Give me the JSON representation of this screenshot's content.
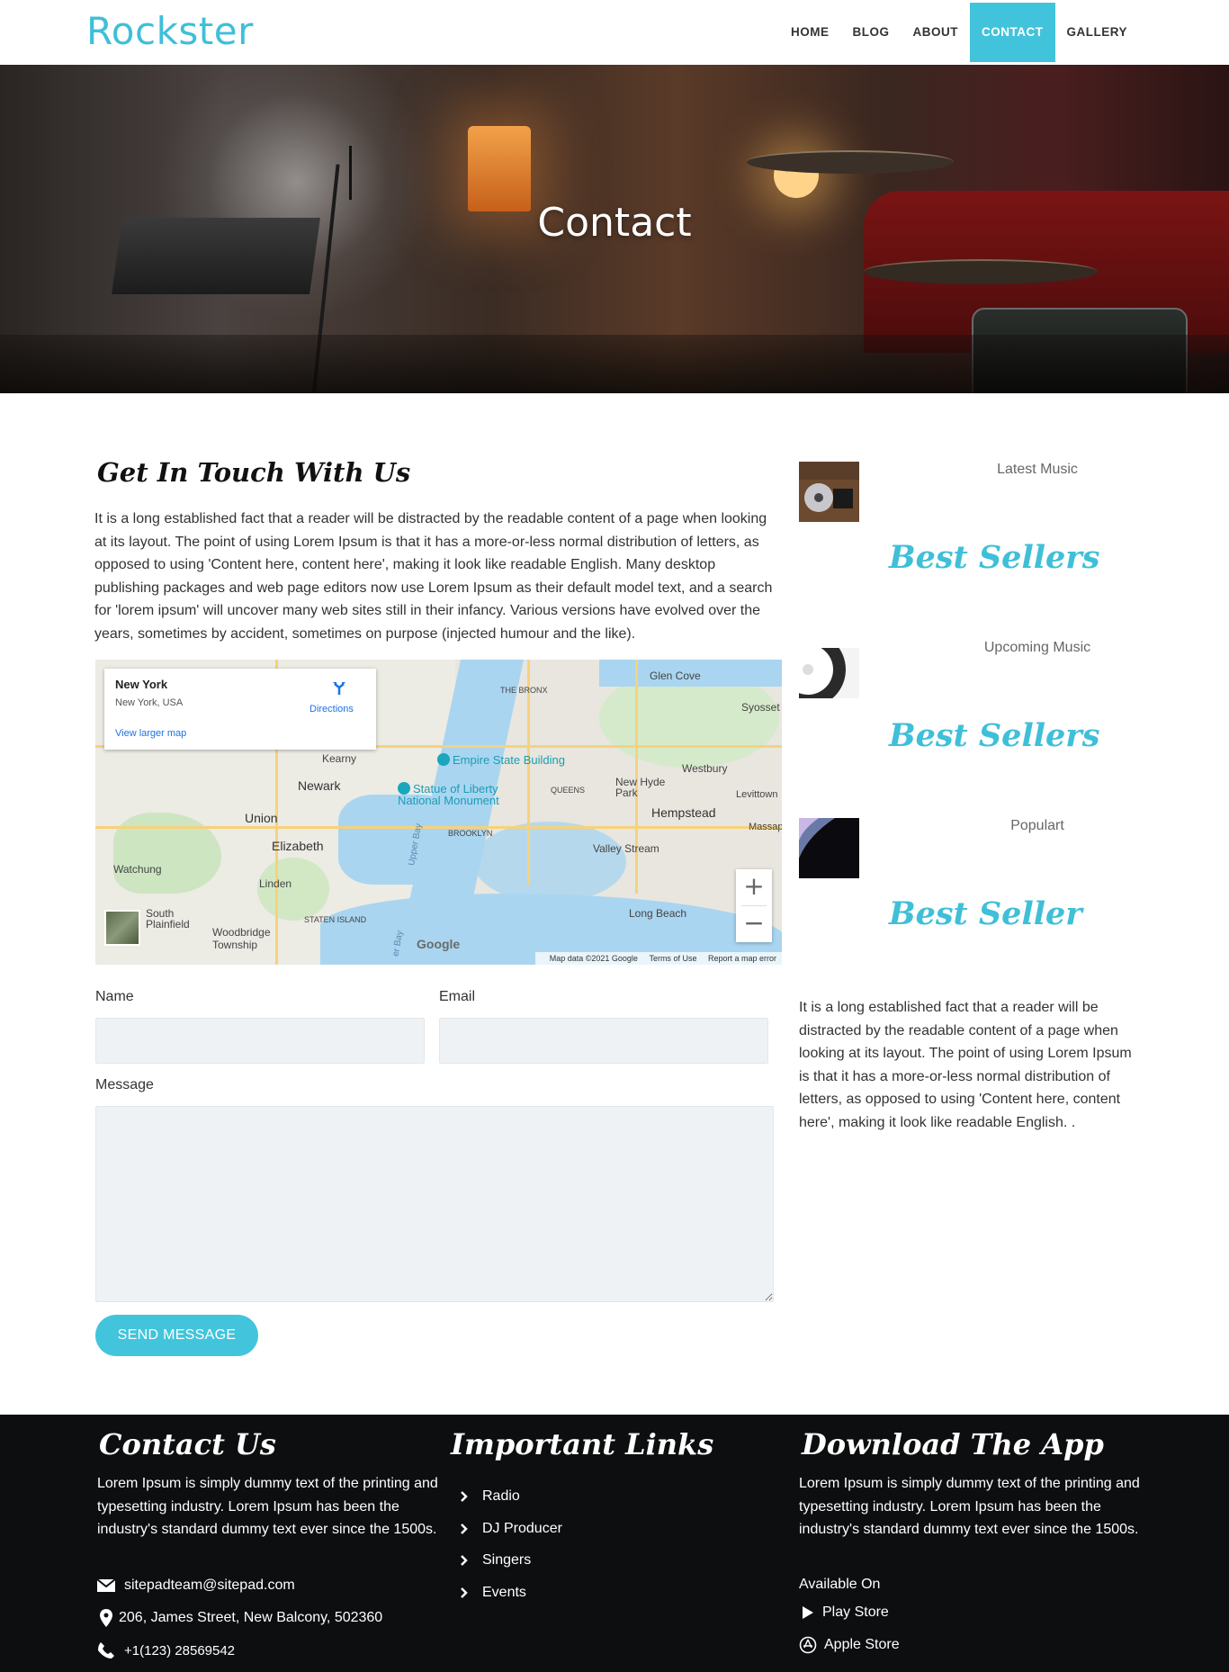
{
  "header": {
    "logo": "Rockster",
    "nav": [
      {
        "label": "HOME",
        "active": false
      },
      {
        "label": "BLOG",
        "active": false
      },
      {
        "label": "ABOUT",
        "active": false
      },
      {
        "label": "CONTACT",
        "active": true
      },
      {
        "label": "GALLERY",
        "active": false
      }
    ]
  },
  "hero": {
    "title": "Contact"
  },
  "main": {
    "title": "Get In Touch With Us",
    "intro": "It is a long established fact that a reader will be distracted by the readable content of a page when looking at its layout. The point of using Lorem Ipsum is that it has a more-or-less normal distribution of letters, as opposed to using 'Content here, content here', making it look like readable English. Many desktop publishing packages and web page editors now use Lorem Ipsum as their default model text, and a search for 'lorem ipsum' will uncover many web sites still in their infancy. Various versions have evolved over the years, sometimes by accident, sometimes on purpose (injected humour and the like)."
  },
  "map": {
    "place": "New York",
    "address": "New York, USA",
    "directions": "Directions",
    "larger_map": "View larger map",
    "labels": {
      "bronx": "THE BRONX",
      "glen_cove": "Glen Cove",
      "syosset": "Syosset",
      "kearny": "Kearny",
      "newark": "Newark",
      "queens": "QUEENS",
      "new_hyde_park": "New Hyde Park",
      "westbury": "Westbury",
      "levittown": "Levittown",
      "union": "Union",
      "hempstead": "Hempstead",
      "brooklyn": "BROOKLYN",
      "elizabeth": "Elizabeth",
      "valley_stream": "Valley Stream",
      "massapequa": "Massap",
      "watchung": "Watchung",
      "linden": "Linden",
      "staten_island": "STATEN ISLAND",
      "south_plainfield": "South Plainfield",
      "woodbridge": "Woodbridge Township",
      "long_beach": "Long Beach",
      "upper_bay": "Upper Bay",
      "lower_bay": "er Bay"
    },
    "poi": {
      "empire": "Empire State Building",
      "liberty": "Statue of Liberty National Monument"
    },
    "google": "Google",
    "map_data": "Map data ©2021 Google",
    "terms": "Terms of Use",
    "report": "Report a map error",
    "zoom_in": "+",
    "zoom_out": "−"
  },
  "form": {
    "name_label": "Name",
    "email_label": "Email",
    "message_label": "Message",
    "name_value": "",
    "email_value": "",
    "message_value": "",
    "send_label": "SEND MESSAGE"
  },
  "sidebar": {
    "items": [
      {
        "label": "Latest Music",
        "title": "Best Sellers"
      },
      {
        "label": "Upcoming Music",
        "title": "Best Sellers"
      },
      {
        "label": "Populart",
        "title": "Best Seller"
      }
    ],
    "text": "It is a long established fact that a reader will be distracted by the readable content of a page when looking at its layout. The point of using Lorem Ipsum is that it has a more-or-less normal distribution of letters, as opposed to using 'Content here, content here', making it look like readable English. ."
  },
  "footer": {
    "contact": {
      "title": "Contact Us",
      "text": "Lorem Ipsum is simply dummy text of the printing and typesetting industry. Lorem Ipsum has been the industry's standard dummy text ever since the 1500s.",
      "email": "sitepadteam@sitepad.com",
      "address": "206, James Street, New Balcony, 502360",
      "phone": "+1(123) 28569542"
    },
    "links": {
      "title": "Important Links",
      "items": [
        "Radio",
        "DJ Producer",
        "Singers",
        "Events"
      ]
    },
    "app": {
      "title": "Download The App",
      "text": "Lorem Ipsum is simply dummy text of the printing and typesetting industry. Lorem Ipsum has been the industry's standard dummy text ever since the 1500s.",
      "available": "Available On",
      "play_store": "Play Store",
      "apple_store": "Apple Store"
    }
  },
  "colors": {
    "accent": "#41c3dc",
    "footer_bg": "#0d0e0f",
    "field_bg": "#eff2f4"
  }
}
